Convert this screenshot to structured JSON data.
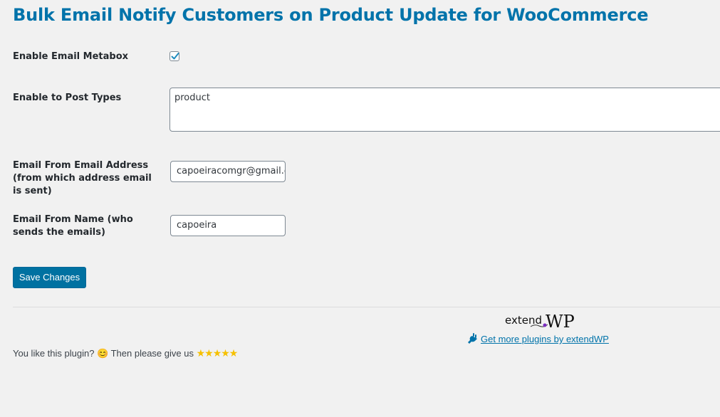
{
  "page": {
    "title": "Bulk Email Notify Customers on Product Update for WooCommerce"
  },
  "settings": {
    "enable_metabox": {
      "label": "Enable Email Metabox",
      "checked": true
    },
    "post_types": {
      "label": "Enable to Post Types",
      "value": "product"
    },
    "email_from_address": {
      "label": "Email From Email Address (from which address email is sent)",
      "value": "capoeiracomgr@gmail.com"
    },
    "email_from_name": {
      "label": "Email From Name (who sends the emails)",
      "value": "capoeira"
    }
  },
  "actions": {
    "save_label": "Save Changes"
  },
  "footer": {
    "logo_extend": "extend",
    "logo_wp": "WP",
    "plugins_link": "Get more plugins by extendWP",
    "rating_text": "You like this plugin? 😊 Then please give us",
    "stars": "★★★★★"
  },
  "colors": {
    "accent": "#0073aa",
    "button": "#0071a1",
    "background": "#f1f1f1",
    "star": "#f6c000",
    "logo_accent": "#7b2cbf"
  }
}
